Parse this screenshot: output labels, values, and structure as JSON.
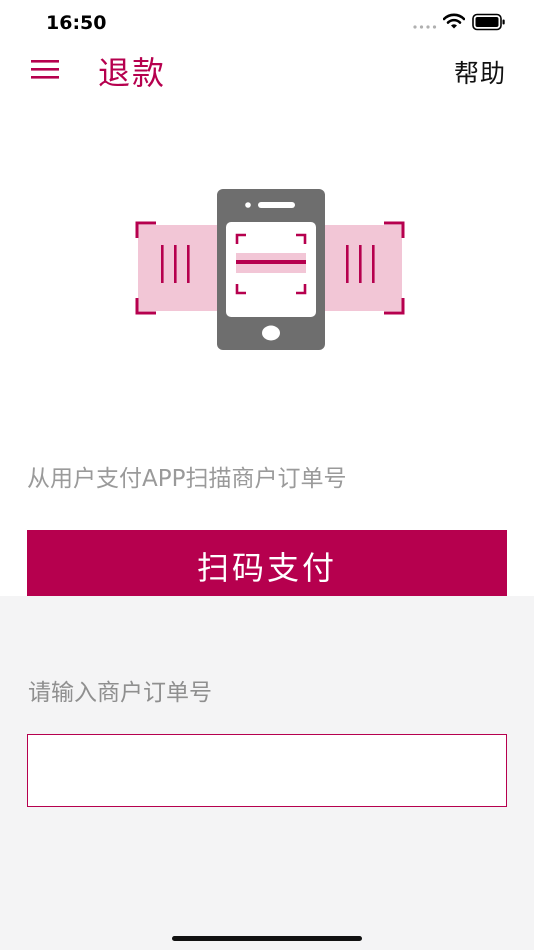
{
  "status_bar": {
    "time": "16:50"
  },
  "nav": {
    "title": "退款",
    "help": "帮助"
  },
  "scan": {
    "instruction": "从用户支付APP扫描商户订单号",
    "button_label": "扫码支付"
  },
  "order": {
    "label": "请输入商户订单号",
    "value": ""
  },
  "colors": {
    "brand": "#b6004e",
    "brand_light": "#f2c6d6",
    "phone": "#6e6e6e"
  }
}
